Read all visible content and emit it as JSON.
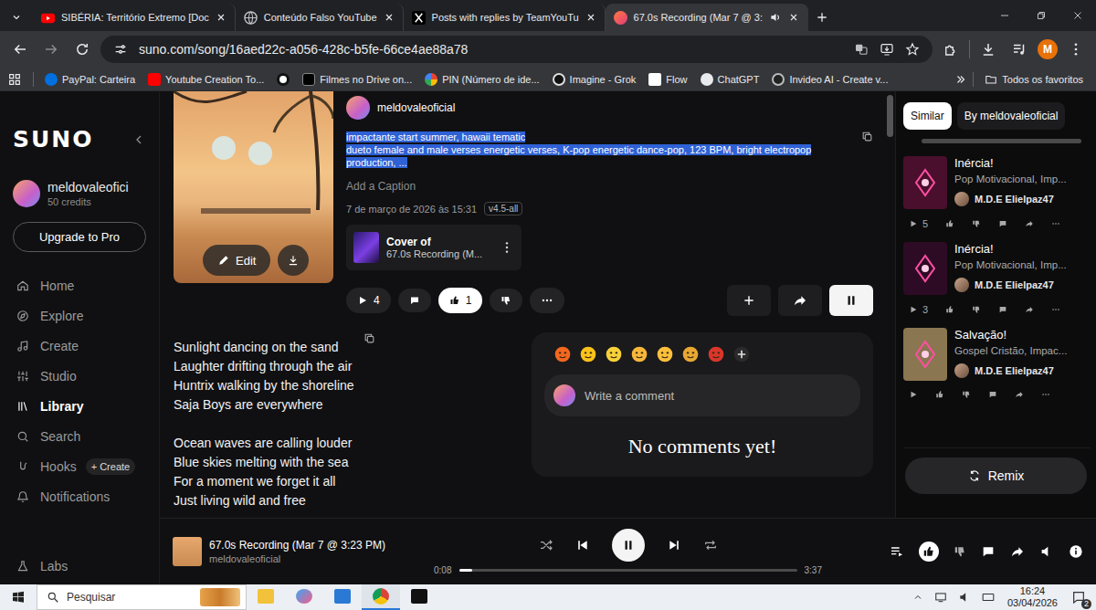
{
  "browser": {
    "tabs": [
      {
        "label": "SIBÉRIA: Território Extremo [Doc",
        "selected": false,
        "audio": false
      },
      {
        "label": "Conteúdo Falso YouTube",
        "selected": false,
        "audio": false
      },
      {
        "label": "Posts with replies by TeamYouTu",
        "selected": false,
        "audio": false
      },
      {
        "label": "67.0s Recording (Mar 7 @ 3:",
        "selected": true,
        "audio": true
      }
    ],
    "url": "suno.com/song/16aed22c-a056-428c-b5fe-66ce4ae88a78",
    "profile": "M",
    "bookmarks": [
      {
        "label": "PayPal: Carteira"
      },
      {
        "label": "Youtube Creation To..."
      },
      {
        "label": ""
      },
      {
        "label": "Filmes no Drive on..."
      },
      {
        "label": "PIN (Número de ide..."
      },
      {
        "label": "Imagine - Grok"
      },
      {
        "label": "Flow"
      },
      {
        "label": "ChatGPT"
      },
      {
        "label": "Invideo AI - Create v..."
      }
    ],
    "all_bookmarks": "Todos os favoritos"
  },
  "sidebar": {
    "logo": "SUNO",
    "user": {
      "name": "meldovaleofici",
      "credits": "50 credits"
    },
    "upgrade": "Upgrade to Pro",
    "nav": [
      {
        "label": "Home",
        "selected": false
      },
      {
        "label": "Explore",
        "selected": false
      },
      {
        "label": "Create",
        "selected": false
      },
      {
        "label": "Studio",
        "selected": false
      },
      {
        "label": "Library",
        "selected": true
      },
      {
        "label": "Search",
        "selected": false
      },
      {
        "label": "Hooks",
        "selected": false,
        "badge": "+ Create"
      },
      {
        "label": "Notifications",
        "selected": false
      }
    ],
    "footer_item": {
      "label": "Labs",
      "selected": false
    }
  },
  "song": {
    "artist": "meldovaleoficial",
    "description": [
      "impactante start summer, hawaii tematic",
      "dueto female and male verses energetic verses, K-pop energetic dance-pop, 123 BPM, bright electropop production, ..."
    ],
    "description_selected": true,
    "edit": "Edit",
    "caption_placeholder": "Add a Caption",
    "date": "7 de março de 2026 às 15:31",
    "version": "v4.5-all",
    "cover_of": {
      "label": "Cover of",
      "title": "67.0s Recording (M..."
    },
    "plays": "4",
    "likes": "1",
    "liked": true,
    "disliked": false,
    "playing": true,
    "lyrics": [
      [
        "Sunlight dancing on the sand",
        "Laughter drifting through the air",
        "Huntrix walking by the shoreline",
        "Saja Boys are everywhere"
      ],
      [
        "Ocean waves are calling louder",
        "Blue skies melting with the sea",
        "For a moment we forget it all",
        "Just living wild and free"
      ]
    ]
  },
  "comments": {
    "reactions": [
      {
        "color": "#f4671f"
      },
      {
        "color": "#fcc21b"
      },
      {
        "color": "#f7d13a"
      },
      {
        "color": "#f9b73a"
      },
      {
        "color": "#fbbf3b"
      },
      {
        "color": "#e8a832"
      },
      {
        "color": "#d9362b"
      }
    ],
    "placeholder": "Write a comment",
    "empty": "No comments yet!"
  },
  "right_panel": {
    "tabs": [
      {
        "label": "Similar",
        "selected": true
      },
      {
        "label": "By meldovaleoficial",
        "selected": false
      }
    ],
    "items": [
      {
        "title": "Inércia!",
        "tags": "Pop Motivacional, Imp...",
        "author": "M.D.E Elielpaz47",
        "plays": "5",
        "color": "#4a0f2c"
      },
      {
        "title": "Inércia!",
        "tags": "Pop Motivacional, Imp...",
        "author": "M.D.E Elielpaz47",
        "plays": "3",
        "color": "#2e0b24"
      },
      {
        "title": "Salvação!",
        "tags": "Gospel Cristão, Impac...",
        "author": "M.D.E Elielpaz47",
        "color": "#8a7650"
      }
    ],
    "remix": "Remix"
  },
  "player": {
    "title": "67.0s Recording (Mar 7 @ 3:23 PM)",
    "artist": "meldovaleoficial",
    "elapsed": "0:08",
    "duration": "3:37",
    "level": 0.04,
    "playing": true,
    "liked": true
  },
  "taskbar": {
    "search": "Pesquisar",
    "apps": [
      {
        "selected": false
      },
      {
        "selected": false
      },
      {
        "selected": false
      },
      {
        "selected": true
      },
      {
        "selected": false
      }
    ],
    "time": "16:24",
    "date": "03/04/2026",
    "notifications": "2"
  }
}
